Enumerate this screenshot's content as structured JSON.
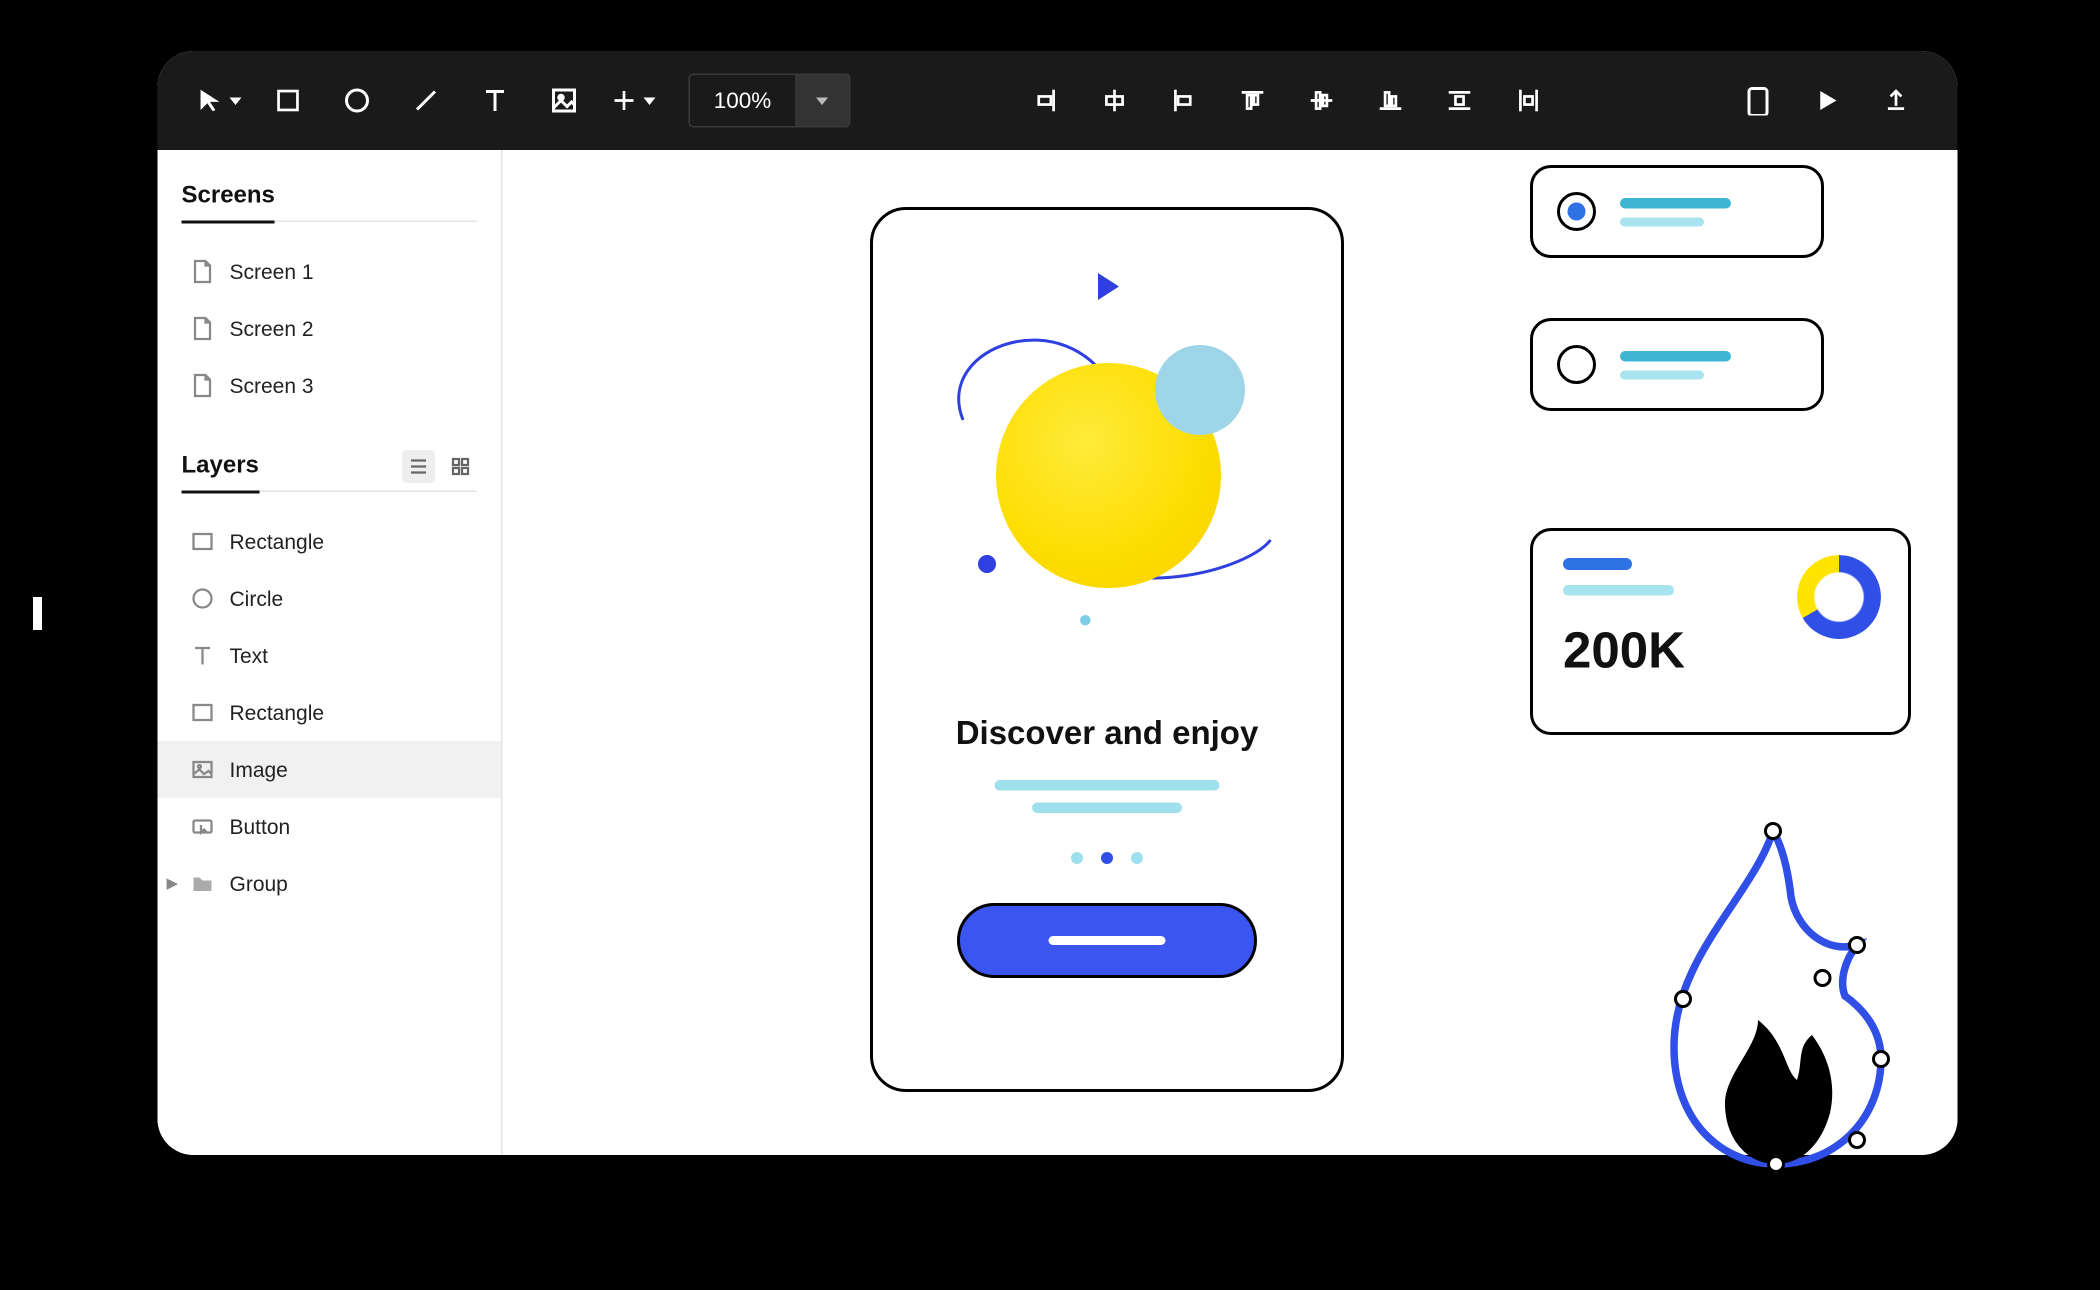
{
  "toolbar": {
    "zoom": "100%"
  },
  "sidebar": {
    "screens_title": "Screens",
    "screens": [
      {
        "label": "Screen 1"
      },
      {
        "label": "Screen 2"
      },
      {
        "label": "Screen 3"
      }
    ],
    "layers_title": "Layers",
    "layers": [
      {
        "label": "Rectangle",
        "icon": "rect"
      },
      {
        "label": "Circle",
        "icon": "circle"
      },
      {
        "label": "Text",
        "icon": "text"
      },
      {
        "label": "Rectangle",
        "icon": "rect"
      },
      {
        "label": "Image",
        "icon": "image",
        "selected": true
      },
      {
        "label": "Button",
        "icon": "button"
      },
      {
        "label": "Group",
        "icon": "folder",
        "expandable": true
      }
    ]
  },
  "mockup": {
    "headline": "Discover and enjoy"
  },
  "stat": {
    "value": "200K"
  }
}
